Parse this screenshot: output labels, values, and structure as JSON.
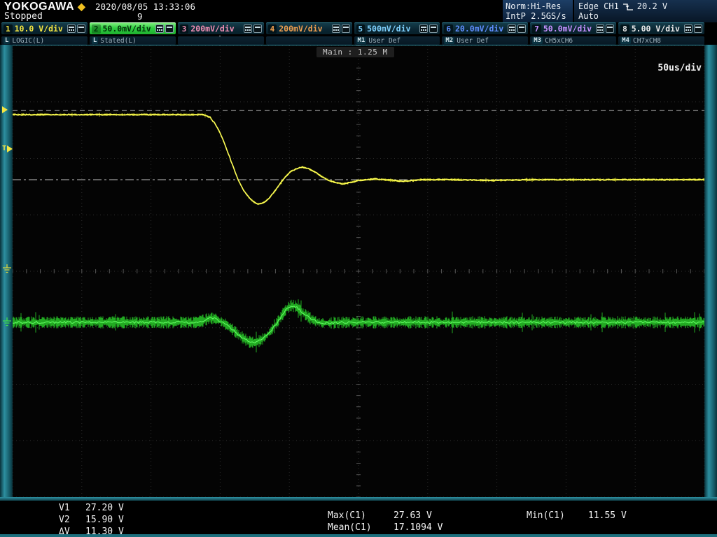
{
  "header": {
    "brand": "YOKOGAWA",
    "status": "Stopped",
    "datetime": "2020/08/05 13:33:06",
    "acq_count": "9",
    "acq_mode": "Norm:Hi-Res",
    "sample_rate": "IntP 2.5GS/s",
    "trigger_source": "Edge CH1",
    "trigger_level": "20.2 V",
    "trigger_mode": "Auto"
  },
  "channels": [
    {
      "num": "1",
      "vdiv": "10.0 V/div",
      "color": "#f5e642",
      "selected": false
    },
    {
      "num": "2",
      "vdiv": "50.0mV/div",
      "color": "#35e03a",
      "selected": true
    },
    {
      "num": "3",
      "vdiv": "200mV/div",
      "color": "#f08fb4",
      "selected": false
    },
    {
      "num": "4",
      "vdiv": "200mV/div",
      "color": "#f0a050",
      "selected": false
    },
    {
      "num": "5",
      "vdiv": "500mV/div",
      "color": "#7fd2ff",
      "selected": false
    },
    {
      "num": "6",
      "vdiv": "20.0mV/div",
      "color": "#5f8fff",
      "selected": false
    },
    {
      "num": "7",
      "vdiv": "50.0mV/div",
      "color": "#c490ff",
      "selected": false
    },
    {
      "num": "8",
      "vdiv": "5.00 V/div",
      "color": "#e8e8e8",
      "selected": false
    }
  ],
  "subchannels": [
    {
      "key": "L",
      "text": "LOGIC(L)"
    },
    {
      "key": "L",
      "text": "Stated(L)"
    },
    {
      "key": "",
      "text": ""
    },
    {
      "key": "",
      "text": ""
    },
    {
      "key": "M1",
      "text": "User Def"
    },
    {
      "key": "M2",
      "text": "User Def"
    },
    {
      "key": "M3",
      "text": "CH5xCH6"
    },
    {
      "key": "M4",
      "text": "CH7xCH8"
    }
  ],
  "plot": {
    "record_length": "Main : 1.25 M",
    "timebase": "50us/div",
    "trigger_time_label": "T",
    "markers": [
      {
        "name": "cursor-v1-marker",
        "type": "triangle",
        "y": 158,
        "color": "#f5e642"
      },
      {
        "name": "trigger-level-marker",
        "type": "T",
        "y": 214,
        "color": "#f5e642"
      },
      {
        "name": "ch1-ground-marker",
        "type": "ground",
        "y": 384,
        "color": "#d6d23e"
      },
      {
        "name": "ch2-ground-marker",
        "type": "ground",
        "y": 460,
        "color": "#3fe04a"
      }
    ]
  },
  "measurements": {
    "rows_left": [
      {
        "label": "V1",
        "value": "27.20 V"
      },
      {
        "label": "V2",
        "value": "15.90 V"
      },
      {
        "label": "ΔV",
        "value": "11.30 V"
      }
    ],
    "rows_center": [
      {
        "label": "Max(C1)",
        "value": "27.63 V"
      },
      {
        "label": "Mean(C1)",
        "value": "17.1094 V"
      }
    ],
    "rows_right": [
      {
        "label": "Min(C1)",
        "value": "11.55 V"
      }
    ]
  },
  "chart_data": {
    "type": "line",
    "title": "Oscilloscope capture, step response",
    "timebase": "50 us/div, 10 divisions",
    "record_length": "1.25 M",
    "sample_rate": "2.5 GS/s",
    "grid": {
      "x_divisions": 10,
      "y_divisions": 8
    },
    "cursors": [
      {
        "name": "V1",
        "value": "27.20 V",
        "y": 93,
        "dash": "7,5"
      },
      {
        "name": "V2",
        "value": "15.90 V",
        "y": 192,
        "dash": "12,4,3,4"
      }
    ],
    "series": [
      {
        "name": "CH1",
        "vdiv": "10.0 V/div",
        "color": "#d8d820",
        "core": "#ffff55",
        "fuzz": 1.3,
        "jitter": 1.6,
        "width": 1.6,
        "points": [
          [
            0,
            99
          ],
          [
            272,
            99
          ],
          [
            282,
            103
          ],
          [
            290,
            113
          ],
          [
            298,
            129
          ],
          [
            306,
            149
          ],
          [
            314,
            171
          ],
          [
            322,
            192
          ],
          [
            330,
            207
          ],
          [
            338,
            218
          ],
          [
            346,
            225
          ],
          [
            352,
            227
          ],
          [
            358,
            225
          ],
          [
            366,
            219
          ],
          [
            374,
            209
          ],
          [
            382,
            198
          ],
          [
            390,
            187
          ],
          [
            398,
            180
          ],
          [
            406,
            176
          ],
          [
            414,
            174
          ],
          [
            422,
            176
          ],
          [
            430,
            180
          ],
          [
            438,
            185
          ],
          [
            446,
            190
          ],
          [
            454,
            194
          ],
          [
            462,
            196
          ],
          [
            470,
            198
          ],
          [
            478,
            197
          ],
          [
            486,
            195
          ],
          [
            494,
            193
          ],
          [
            506,
            192
          ],
          [
            518,
            191
          ],
          [
            530,
            192
          ],
          [
            542,
            193
          ],
          [
            554,
            194
          ],
          [
            566,
            194
          ],
          [
            582,
            192
          ],
          [
            602,
            192
          ],
          [
            632,
            192
          ],
          [
            682,
            193
          ],
          [
            742,
            192
          ],
          [
            988,
            192
          ]
        ]
      },
      {
        "name": "CH2",
        "vdiv": "50.0 mV/div",
        "color": "#28c828",
        "core": "#66ff66",
        "fuzz": 6.5,
        "jitter": 3.0,
        "width": 1.0,
        "points": [
          [
            0,
            396
          ],
          [
            262,
            396
          ],
          [
            274,
            393
          ],
          [
            282,
            390
          ],
          [
            290,
            391
          ],
          [
            298,
            395
          ],
          [
            306,
            400
          ],
          [
            314,
            406
          ],
          [
            322,
            413
          ],
          [
            330,
            419
          ],
          [
            338,
            424
          ],
          [
            346,
            425
          ],
          [
            354,
            422
          ],
          [
            362,
            416
          ],
          [
            370,
            407
          ],
          [
            378,
            396
          ],
          [
            386,
            384
          ],
          [
            392,
            376
          ],
          [
            398,
            372
          ],
          [
            404,
            373
          ],
          [
            410,
            378
          ],
          [
            418,
            385
          ],
          [
            426,
            391
          ],
          [
            434,
            395
          ],
          [
            442,
            397
          ],
          [
            452,
            397
          ],
          [
            472,
            396
          ],
          [
            988,
            396
          ]
        ]
      }
    ]
  }
}
